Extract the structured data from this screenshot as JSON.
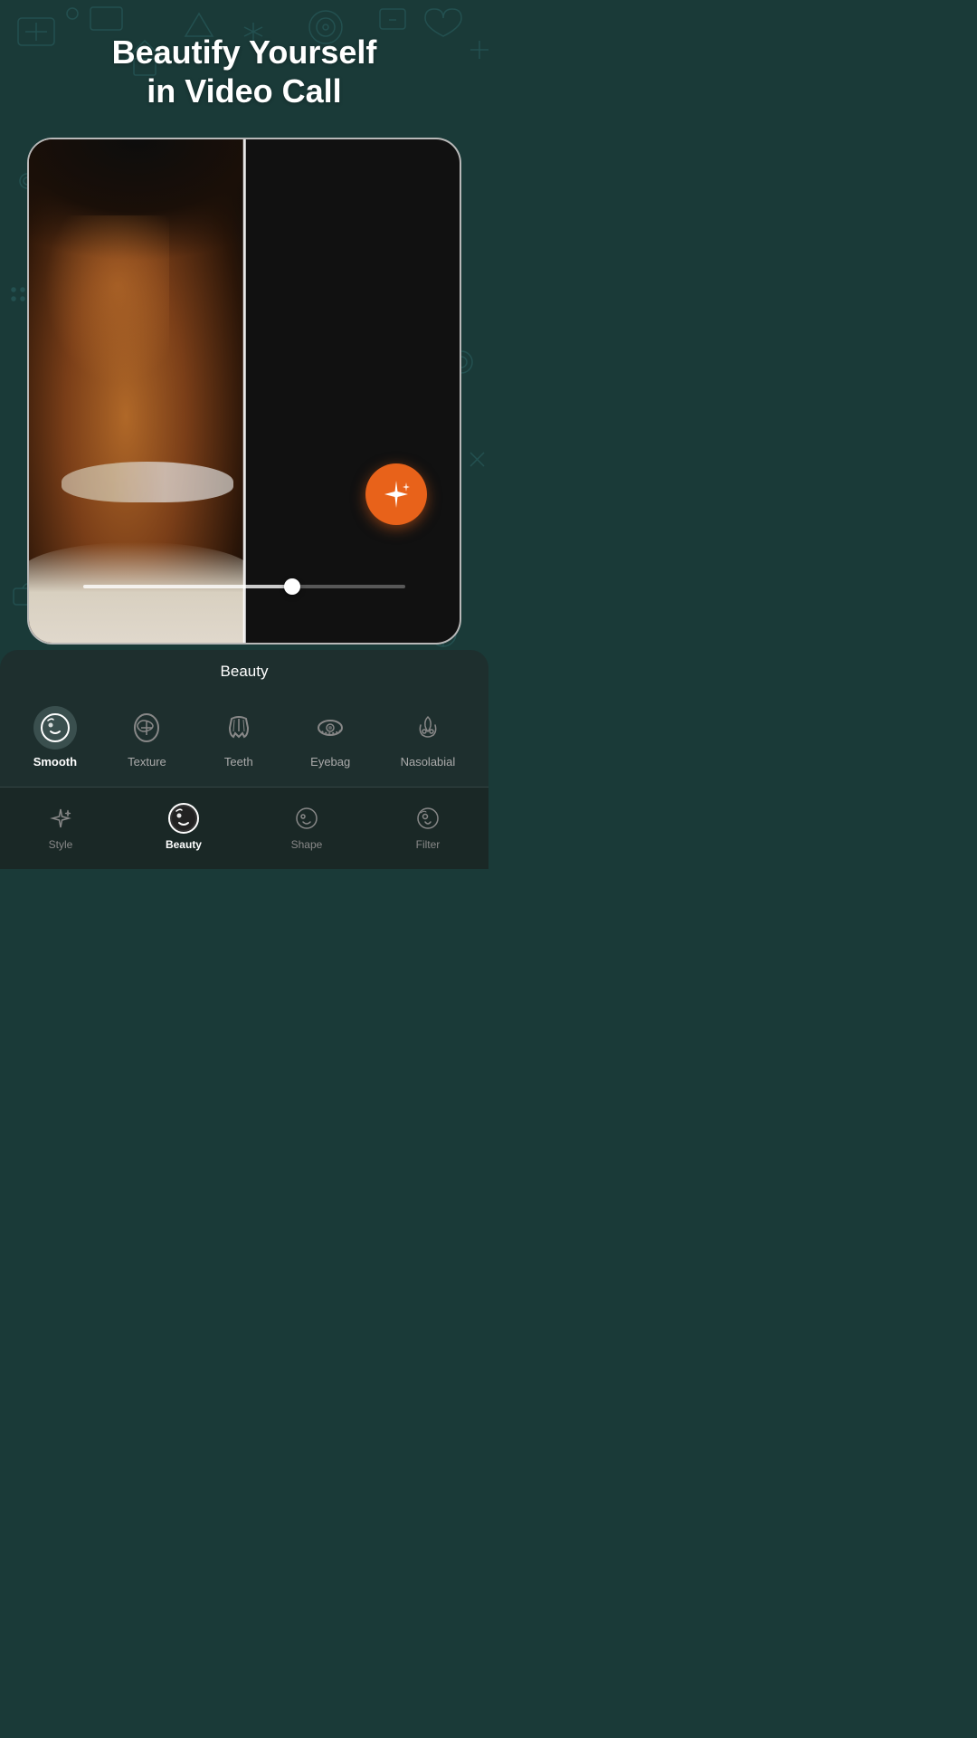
{
  "header": {
    "title_line1": "Beautify Yourself",
    "title_line2": "in Video Call"
  },
  "panel": {
    "title": "Beauty"
  },
  "beauty_items": [
    {
      "id": "smooth",
      "label": "Smooth",
      "active": true
    },
    {
      "id": "texture",
      "label": "Texture",
      "active": false
    },
    {
      "id": "teeth",
      "label": "Teeth",
      "active": false
    },
    {
      "id": "eyebag",
      "label": "Eyebag",
      "active": false
    },
    {
      "id": "nasolabial",
      "label": "Nasolabial",
      "active": false
    }
  ],
  "nav_items": [
    {
      "id": "style",
      "label": "Style",
      "active": false
    },
    {
      "id": "beauty",
      "label": "Beauty",
      "active": true
    },
    {
      "id": "shape",
      "label": "Shape",
      "active": false
    },
    {
      "id": "filter",
      "label": "Filter",
      "active": false
    }
  ],
  "slider": {
    "value": 65
  }
}
